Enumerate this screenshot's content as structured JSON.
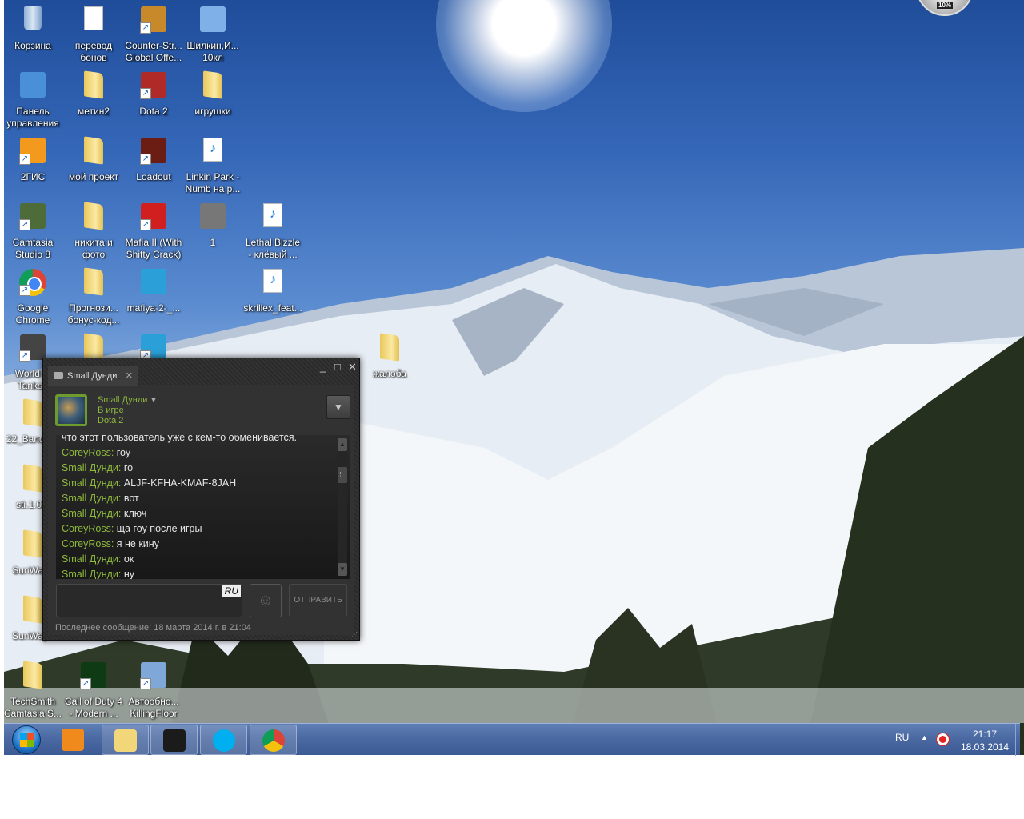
{
  "desktop": {
    "icons": [
      {
        "label": "Корзина",
        "type": "bin"
      },
      {
        "label": "перевод\nбонов",
        "type": "doc"
      },
      {
        "label": "Counter-Str...\nGlobal Offe...",
        "type": "app",
        "color": "#c8892a",
        "shortcut": true
      },
      {
        "label": "Шилкин,И...\n10кл",
        "type": "app",
        "color": "#7fb1e8"
      },
      {
        "label": "Панель\nуправления",
        "type": "app",
        "color": "#4a90d9"
      },
      {
        "label": "метин2",
        "type": "folder"
      },
      {
        "label": "Dota 2",
        "type": "app",
        "color": "#b02a28",
        "shortcut": true
      },
      {
        "label": "игрушки",
        "type": "folder"
      },
      {
        "label": "2ГИС",
        "type": "app",
        "color": "#f39a1e",
        "shortcut": true
      },
      {
        "label": "мой проект",
        "type": "folder"
      },
      {
        "label": "Loadout",
        "type": "app",
        "color": "#6b1d14",
        "shortcut": true
      },
      {
        "label": "Linkin Park -\nNumb на р...",
        "type": "mp3"
      },
      {
        "label": "Camtasia\nStudio 8",
        "type": "app",
        "color": "#4e6b3a",
        "shortcut": true
      },
      {
        "label": "никита и\nфото",
        "type": "folder"
      },
      {
        "label": "Mafia II (With\nShitty Crack)",
        "type": "app",
        "color": "#d11f1f",
        "shortcut": true
      },
      {
        "label": "1",
        "type": "app",
        "color": "#777"
      },
      {
        "label": "Lethal Bizzle\n- клёвый ...",
        "type": "mp3"
      },
      {
        "label": "Google\nChrome",
        "type": "chrome",
        "shortcut": true
      },
      {
        "label": "Прогнози...\nбонус-код...",
        "type": "folder"
      },
      {
        "label": "mafiya-2-_...",
        "type": "app",
        "color": "#2a9fd8"
      },
      {
        "label": "skrillex_feat...",
        "type": "mp3"
      },
      {
        "label": "World of\nTanks -",
        "type": "app",
        "color": "#444",
        "shortcut": true
      },
      {
        "label": "",
        "type": "folder"
      },
      {
        "label": "",
        "type": "app",
        "color": "#2a9fd8",
        "shortcut": true
      },
      {
        "label": "жалоба",
        "type": "folder"
      },
      {
        "label": "22_Bandic...",
        "type": "folder"
      },
      {
        "label": "sti.1.0.0",
        "type": "folder"
      },
      {
        "label": "SunWay_",
        "type": "folder"
      },
      {
        "label": "SunWay+",
        "type": "folder"
      },
      {
        "label": "TechSmith\nCamtasia S...",
        "type": "folder"
      },
      {
        "label": "Call of Duty 4\n- Modern ...",
        "type": "app",
        "color": "#0f3b14",
        "shortcut": true
      },
      {
        "label": "Автообно...\nKillingFloor",
        "type": "app",
        "color": "#7fa8d8",
        "shortcut": true
      }
    ],
    "gadget": {
      "value": "10%"
    }
  },
  "chat": {
    "tab_label": "Small Дунди",
    "friend": {
      "name": "Small Дунди",
      "status": "В игре",
      "game": "Dota 2"
    },
    "messages": [
      {
        "who": "",
        "text": "что этот пользователь уже с кем-то обменивается."
      },
      {
        "who": "CoreyRoss:",
        "text": " гоу"
      },
      {
        "who": "Small Дунди:",
        "text": " го"
      },
      {
        "who": "Small Дунди:",
        "text": " ALJF-KFHA-KMAF-8JAH"
      },
      {
        "who": "Small Дунди:",
        "text": " вот"
      },
      {
        "who": "Small Дунди:",
        "text": " ключ"
      },
      {
        "who": "CoreyRoss:",
        "text": " ща гоу после игры"
      },
      {
        "who": "CoreyRoss:",
        "text": " я не кину"
      },
      {
        "who": "Small Дунди:",
        "text": " ок"
      },
      {
        "who": "Small Дунди:",
        "text": " ну"
      }
    ],
    "input_value": "",
    "input_lang": "RU",
    "send_label": "ОТПРАВИТЬ",
    "last_message": "Последнее сообщение: 18 марта 2014 г. в 21:04",
    "accent": "#8fba3d"
  },
  "taskbar": {
    "apps": [
      {
        "name": "media-player",
        "color": "#f08a1c"
      },
      {
        "name": "explorer",
        "color": "#f2d67a"
      },
      {
        "name": "steam",
        "color": "#1b1b1b"
      },
      {
        "name": "skype",
        "color": "#00aff0"
      },
      {
        "name": "chrome",
        "color": "#db4437"
      }
    ],
    "lang": "RU",
    "time": "21:17",
    "date": "18.03.2014"
  }
}
